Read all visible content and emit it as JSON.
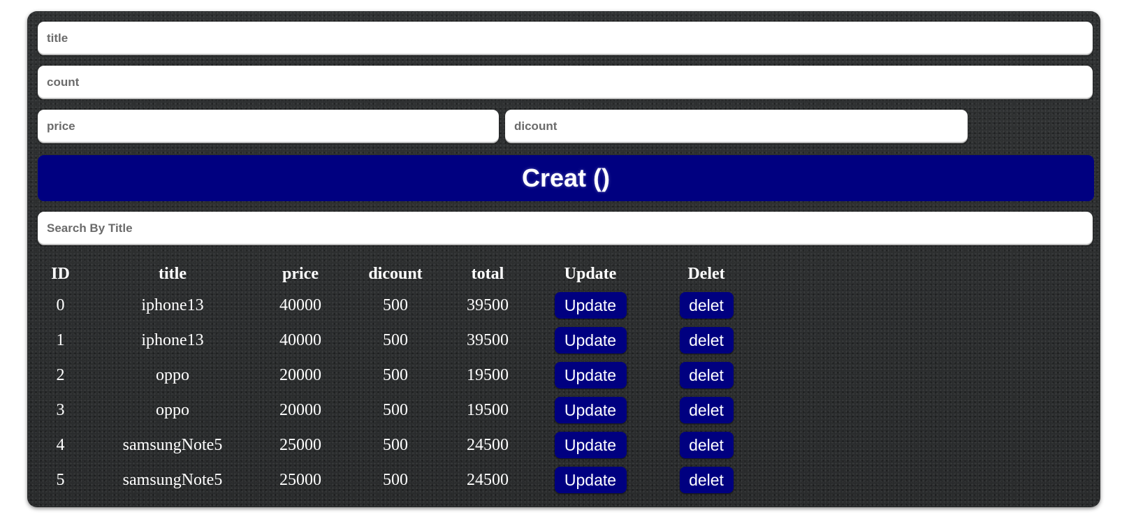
{
  "form": {
    "title_placeholder": "title",
    "count_placeholder": "count",
    "price_placeholder": "price",
    "discount_placeholder": "dicount",
    "create_label": "Creat ()",
    "search_placeholder": "Search By Title"
  },
  "table": {
    "headers": [
      "ID",
      "title",
      "price",
      "dicount",
      "total",
      "Update",
      "Delet"
    ],
    "rows": [
      {
        "id": "0",
        "title": "iphone13",
        "price": "40000",
        "discount": "500",
        "total": "39500",
        "update_label": "Update",
        "delete_label": "delet"
      },
      {
        "id": "1",
        "title": "iphone13",
        "price": "40000",
        "discount": "500",
        "total": "39500",
        "update_label": "Update",
        "delete_label": "delet"
      },
      {
        "id": "2",
        "title": "oppo",
        "price": "20000",
        "discount": "500",
        "total": "19500",
        "update_label": "Update",
        "delete_label": "delet"
      },
      {
        "id": "3",
        "title": "oppo",
        "price": "20000",
        "discount": "500",
        "total": "19500",
        "update_label": "Update",
        "delete_label": "delet"
      },
      {
        "id": "4",
        "title": "samsungNote5",
        "price": "25000",
        "discount": "500",
        "total": "24500",
        "update_label": "Update",
        "delete_label": "delet"
      },
      {
        "id": "5",
        "title": "samsungNote5",
        "price": "25000",
        "discount": "500",
        "total": "24500",
        "update_label": "Update",
        "delete_label": "delet"
      }
    ]
  },
  "colors": {
    "button_bg": "#000080",
    "panel_bg": "#2a2c2d",
    "text": "#ffffff"
  }
}
